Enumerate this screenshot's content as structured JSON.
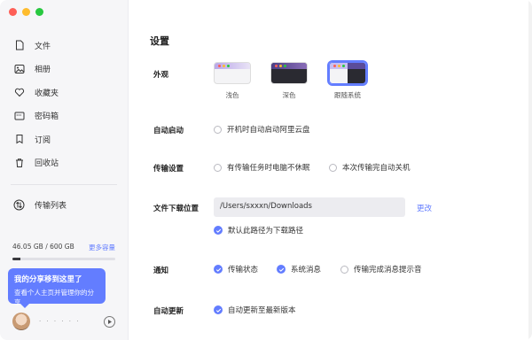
{
  "sidebar": {
    "nav": [
      {
        "label": "文件",
        "icon": "file-icon"
      },
      {
        "label": "相册",
        "icon": "photo-icon"
      },
      {
        "label": "收藏夹",
        "icon": "heart-icon"
      },
      {
        "label": "密码箱",
        "icon": "safe-icon"
      },
      {
        "label": "订阅",
        "icon": "bookmark-icon"
      },
      {
        "label": "回收站",
        "icon": "trash-icon"
      }
    ],
    "transfer": {
      "label": "传输列表",
      "icon": "transfer-icon"
    },
    "storage": {
      "used_text": "46.05 GB / 600 GB",
      "more_label": "更多容量",
      "used_fraction": 0.077
    },
    "tip": {
      "title": "我的分享移到这里了",
      "subtitle": "查看个人主页并管理你的分享"
    },
    "user": {
      "name": "· · · · · ·"
    }
  },
  "main": {
    "title": "设置",
    "appearance": {
      "label": "外观",
      "options": [
        {
          "label": "浅色",
          "selected": false
        },
        {
          "label": "深色",
          "selected": false
        },
        {
          "label": "跟随系统",
          "selected": true
        }
      ]
    },
    "autostart": {
      "label": "自动启动",
      "option": "开机时自动启动阿里云盘",
      "checked": false
    },
    "transfer": {
      "label": "传输设置",
      "options": [
        {
          "label": "有传输任务时电脑不休眠",
          "checked": false
        },
        {
          "label": "本次传输完自动关机",
          "checked": false
        }
      ]
    },
    "download": {
      "label": "文件下载位置",
      "path": "/Users/sxxxn/Downloads",
      "change_label": "更改",
      "default_option": "默认此路径为下载路径",
      "default_checked": true
    },
    "notify": {
      "label": "通知",
      "options": [
        {
          "label": "传输状态",
          "checked": true
        },
        {
          "label": "系统消息",
          "checked": true
        },
        {
          "label": "传输完成消息提示音",
          "checked": false
        }
      ]
    },
    "update": {
      "label": "自动更新",
      "option": "自动更新至最新版本",
      "checked": true
    }
  },
  "colors": {
    "accent": "#637dff",
    "sidebar_bg": "#f6f6f8"
  }
}
